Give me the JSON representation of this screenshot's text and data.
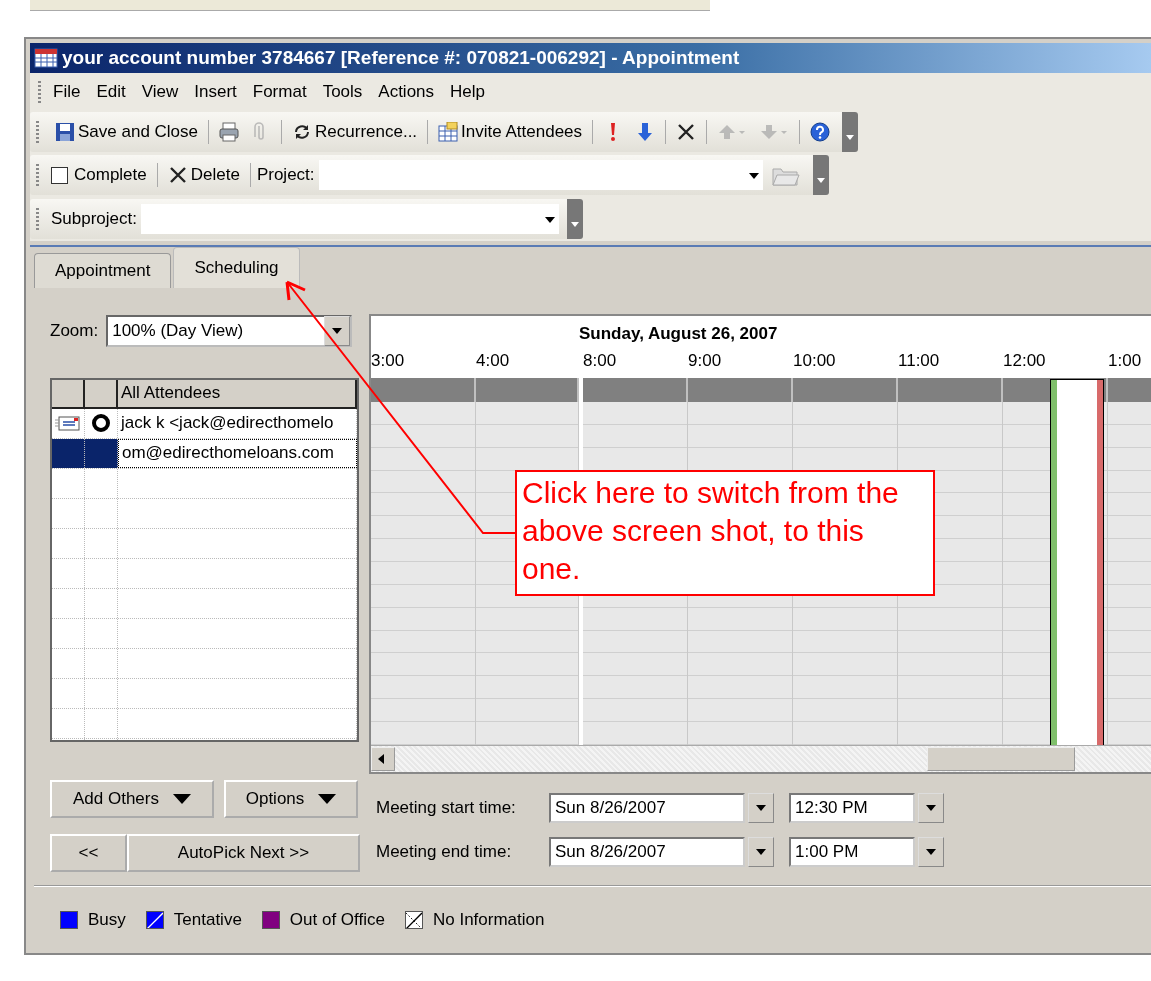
{
  "window": {
    "title": "your account number 3784667 [Reference #: 070821-006292] - Appointment"
  },
  "menu": [
    "File",
    "Edit",
    "View",
    "Insert",
    "Format",
    "Tools",
    "Actions",
    "Help"
  ],
  "toolbar": [
    {
      "kind": "save",
      "label": "Save and Close"
    },
    {
      "kind": "print"
    },
    {
      "kind": "clip"
    },
    {
      "kind": "recur",
      "label": "Recurrence..."
    },
    {
      "kind": "invite",
      "label": "Invite Attendees"
    },
    {
      "kind": "high"
    },
    {
      "kind": "low"
    },
    {
      "kind": "delete"
    },
    {
      "kind": "up"
    },
    {
      "kind": "down"
    },
    {
      "kind": "help"
    }
  ],
  "task_bar": {
    "complete": {
      "label": "Complete",
      "checked": false
    },
    "delete": "Delete",
    "project_label": "Project:"
  },
  "subproject_label": "Subproject:",
  "tabs": [
    {
      "label": "Appointment",
      "selected": false
    },
    {
      "label": "Scheduling",
      "selected": true
    }
  ],
  "zoom": {
    "label": "Zoom:",
    "value": "100% (Day View)"
  },
  "attendees": {
    "header": "All Attendees",
    "rows": [
      {
        "name": "jack k <jack@edirecthomelo",
        "selected": false,
        "kind": "organizer"
      },
      {
        "name": "om@edirecthomeloans.com",
        "selected": true,
        "kind": "attendee"
      }
    ]
  },
  "schedule": {
    "date": "Sunday, August 26, 2007",
    "columns": [
      {
        "time": "3:00",
        "break_after": false,
        "meeting": false
      },
      {
        "time": "4:00",
        "break_after": true,
        "meeting": false
      },
      {
        "time": "8:00",
        "break_after": false,
        "meeting": false
      },
      {
        "time": "9:00",
        "break_after": false,
        "meeting": false
      },
      {
        "time": "10:00",
        "break_after": false,
        "meeting": false
      },
      {
        "time": "11:00",
        "break_after": false,
        "meeting": false
      },
      {
        "time": "12:00",
        "break_after": false,
        "meeting": true
      },
      {
        "time": "1:00",
        "break_after": false,
        "meeting": false
      }
    ]
  },
  "buttons": {
    "add_others": "Add Others",
    "options": "Options",
    "back": "<<",
    "autopick": "AutoPick Next >>"
  },
  "meeting": {
    "start_label": "Meeting start time:",
    "start_date": "Sun 8/26/2007",
    "start_time": "12:30 PM",
    "end_label": "Meeting end time:",
    "end_date": "Sun 8/26/2007",
    "end_time": "1:00 PM"
  },
  "legend": [
    {
      "label": "Busy",
      "kind": "solid",
      "color": "#0000ff"
    },
    {
      "label": "Tentative",
      "kind": "hatched",
      "color": "#0000ff"
    },
    {
      "label": "Out of Office",
      "kind": "solid",
      "color": "#800080"
    },
    {
      "label": "No Information",
      "kind": "hatched",
      "color": "#ffffff"
    }
  ],
  "callout": {
    "text": "Click here to switch from the above screen shot, to this one."
  }
}
